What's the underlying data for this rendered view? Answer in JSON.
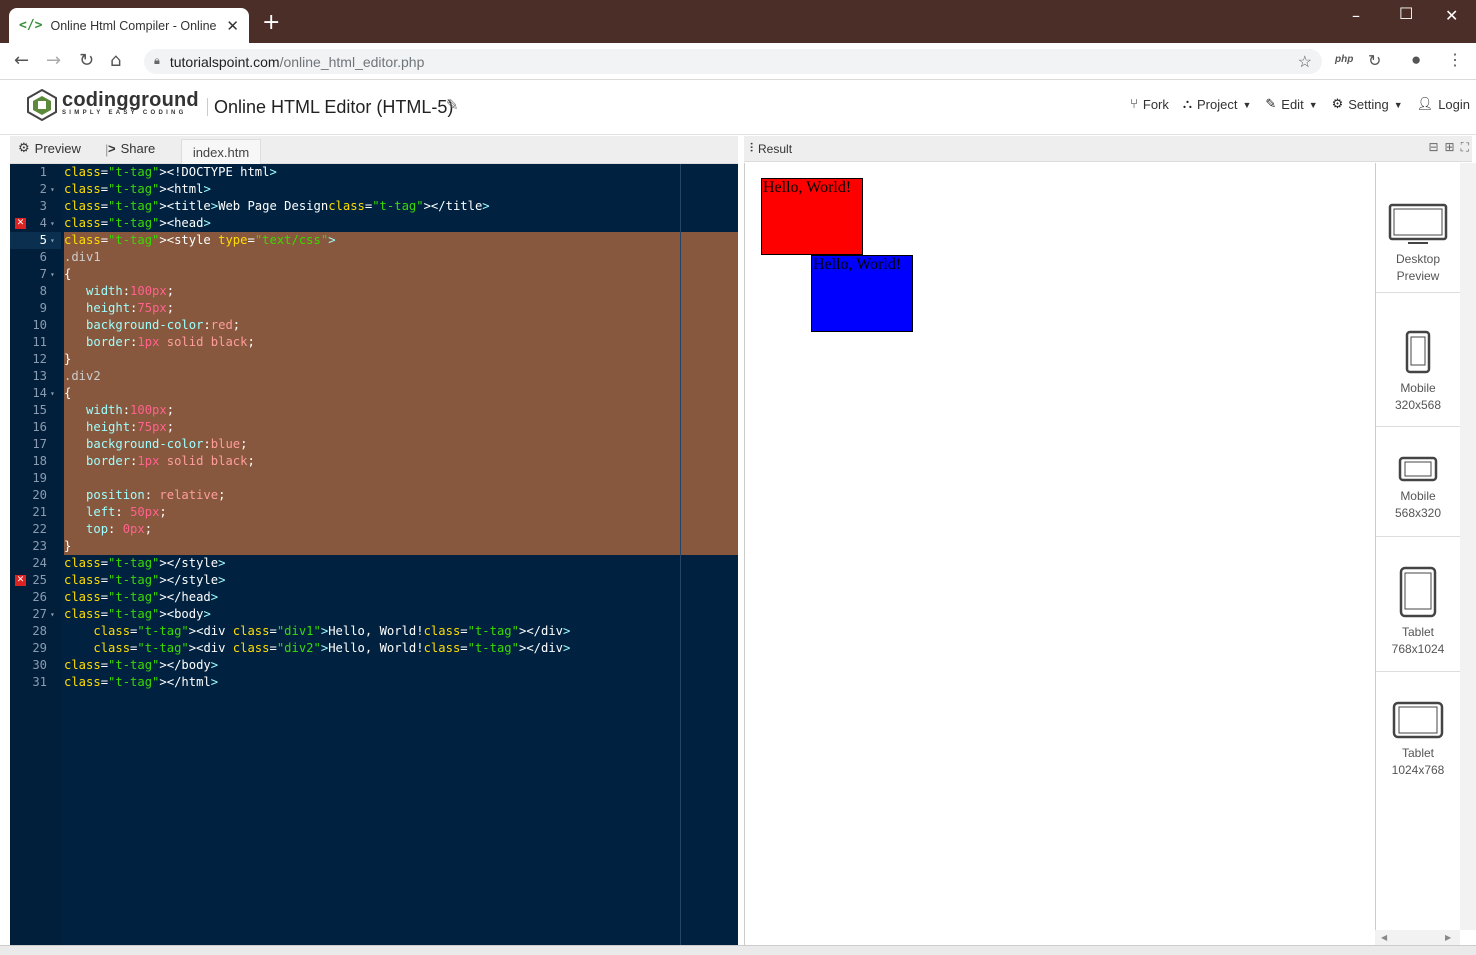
{
  "browser": {
    "tab_title": "Online Html Compiler - Online H",
    "tab_icon": "</>",
    "url_host": "tutorialspoint.com",
    "url_path": "/online_html_editor.php",
    "ext_php": "php"
  },
  "header": {
    "logo_name": "codingground",
    "logo_tagline": "SIMPLY EASY CODING",
    "title": "Online HTML Editor (HTML-5)",
    "menu": [
      {
        "label": "Fork"
      },
      {
        "label": "Project"
      },
      {
        "label": "Edit"
      },
      {
        "label": "Setting"
      },
      {
        "label": "Login"
      }
    ]
  },
  "left_toolbar": {
    "preview": "Preview",
    "separator": "|",
    "share": "Share",
    "file_tab": "index.htm"
  },
  "editor": {
    "lines": [
      {
        "n": "1",
        "code": "<!DOCTYPE html>"
      },
      {
        "n": "2",
        "code": "<html>"
      },
      {
        "n": "3",
        "code": "<title>Web Page Design</title>"
      },
      {
        "n": "4",
        "code": "<head>"
      },
      {
        "n": "5",
        "code": "<style type=\"text/css\">"
      },
      {
        "n": "6",
        "code": ".div1"
      },
      {
        "n": "7",
        "code": "{"
      },
      {
        "n": "8",
        "code": "   width:100px;"
      },
      {
        "n": "9",
        "code": "   height:75px;"
      },
      {
        "n": "10",
        "code": "   background-color:red;"
      },
      {
        "n": "11",
        "code": "   border:1px solid black;"
      },
      {
        "n": "12",
        "code": "}"
      },
      {
        "n": "13",
        "code": ".div2"
      },
      {
        "n": "14",
        "code": "{"
      },
      {
        "n": "15",
        "code": "   width:100px;"
      },
      {
        "n": "16",
        "code": "   height:75px;"
      },
      {
        "n": "17",
        "code": "   background-color:blue;"
      },
      {
        "n": "18",
        "code": "   border:1px solid black;"
      },
      {
        "n": "19",
        "code": ""
      },
      {
        "n": "20",
        "code": "   position: relative;"
      },
      {
        "n": "21",
        "code": "   left: 50px;"
      },
      {
        "n": "22",
        "code": "   top: 0px;"
      },
      {
        "n": "23",
        "code": "}"
      },
      {
        "n": "24",
        "code": "</style>"
      },
      {
        "n": "25",
        "code": "</style>"
      },
      {
        "n": "26",
        "code": "</head>"
      },
      {
        "n": "27",
        "code": "<body>"
      },
      {
        "n": "28",
        "code": "    <div class=\"div1\">Hello, World!</div>"
      },
      {
        "n": "29",
        "code": "    <div class=\"div2\">Hello, World!</div>"
      },
      {
        "n": "30",
        "code": "</body>"
      },
      {
        "n": "31",
        "code": "</html>"
      }
    ],
    "error_lines": [
      "4",
      "25"
    ],
    "fold_lines": [
      "2",
      "4",
      "5",
      "7",
      "14",
      "27"
    ]
  },
  "result": {
    "label": "Result",
    "div1_text": "Hello, World!",
    "div2_text": "Hello, World!",
    "div1_color": "#ff0000",
    "div2_color": "#0000ff"
  },
  "devices": [
    {
      "name": "Desktop",
      "size": "Preview"
    },
    {
      "name": "Mobile",
      "size": "320x568"
    },
    {
      "name": "Mobile",
      "size": "568x320"
    },
    {
      "name": "Tablet",
      "size": "768x1024"
    },
    {
      "name": "Tablet",
      "size": "1024x768"
    }
  ]
}
